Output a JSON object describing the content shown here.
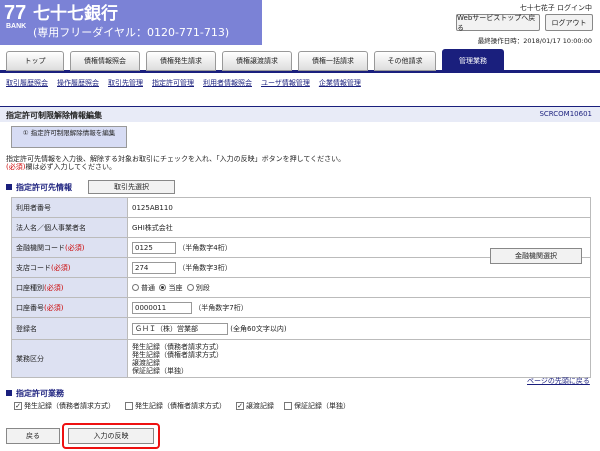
{
  "header": {
    "logo_mark": "77",
    "logo_sub": "BANK",
    "bank_name": "七十七銀行",
    "phone": "(専用フリーダイヤル：0120-771-713)",
    "user_login": "七十七花子 ログイン中",
    "service_top_label": "Webサービストップへ戻る",
    "logout_label": "ログアウト",
    "last_operation": "最終操作日時：2018/01/17 10:00:00"
  },
  "tabs": [
    "トップ",
    "債権情報照会",
    "債権発生請求",
    "債権譲渡請求",
    "債権一括請求",
    "その他請求",
    "管理業務"
  ],
  "subnav": [
    "取引履歴照会",
    "操作履歴照会",
    "取引先管理",
    "指定許可管理",
    "利用者情報照会",
    "ユーザ情報管理",
    "企業情報管理"
  ],
  "page": {
    "title": "指定許可制限解除情報編集",
    "screen_id": "SCRCOM10601",
    "step": "① 指定許可制限解除情報を編集",
    "instruction_1": "指定許可先情報を入力後、解除する対象お取引にチェックを入れ、「入力の反映」ボタンを押してください。",
    "instruction_req": "(必須)",
    "instruction_2": "欄は必ず入力してください。"
  },
  "section1": {
    "title": "指定許可先情報",
    "select_button": "取引先選択"
  },
  "form": {
    "user_number_label": "利用者番号",
    "user_number": "0125AB110",
    "company_label": "法人名／個人事業者名",
    "company": "GHI株式会社",
    "bank_code_label": "金融機関コード",
    "bank_code": "0125",
    "bank_code_hint": "（半角数字4桁）",
    "branch_label": "支店コード",
    "branch_code": "274",
    "branch_hint": "（半角数字3桁）",
    "account_type_label": "口座種別",
    "account_types": [
      "普通",
      "当座",
      "別段"
    ],
    "account_type_selected": "当座",
    "account_no_label": "口座番号",
    "account_no": "0000011",
    "account_hint": "（半角数字7桁）",
    "reg_name_label": "登録名",
    "reg_name": "ＧＨＩ（株）営業部",
    "reg_name_hint": "(全角60文字以内)",
    "business_label": "業務区分",
    "business_lines": [
      "発生記録（債務者請求方式）",
      "発生記録（債権者請求方式）",
      "譲渡記録",
      "保証記録（単独）"
    ],
    "required": "(必須)",
    "fin_inst_button": "金融機関選択"
  },
  "page_top_link": "ページの先頭に戻る",
  "section2": {
    "title": "指定許可業務",
    "items": [
      {
        "label": "発生記録（債務者請求方式）",
        "checked": true
      },
      {
        "label": "発生記録（債権者請求方式）",
        "checked": false
      },
      {
        "label": "譲渡記録",
        "checked": true
      },
      {
        "label": "保証記録（単独）",
        "checked": false
      }
    ]
  },
  "buttons": {
    "back": "戻る",
    "apply": "入力の反映"
  },
  "colors": {
    "brand": "#7b82d6",
    "nav": "#1a1f7d",
    "highlight": "#e11111"
  }
}
